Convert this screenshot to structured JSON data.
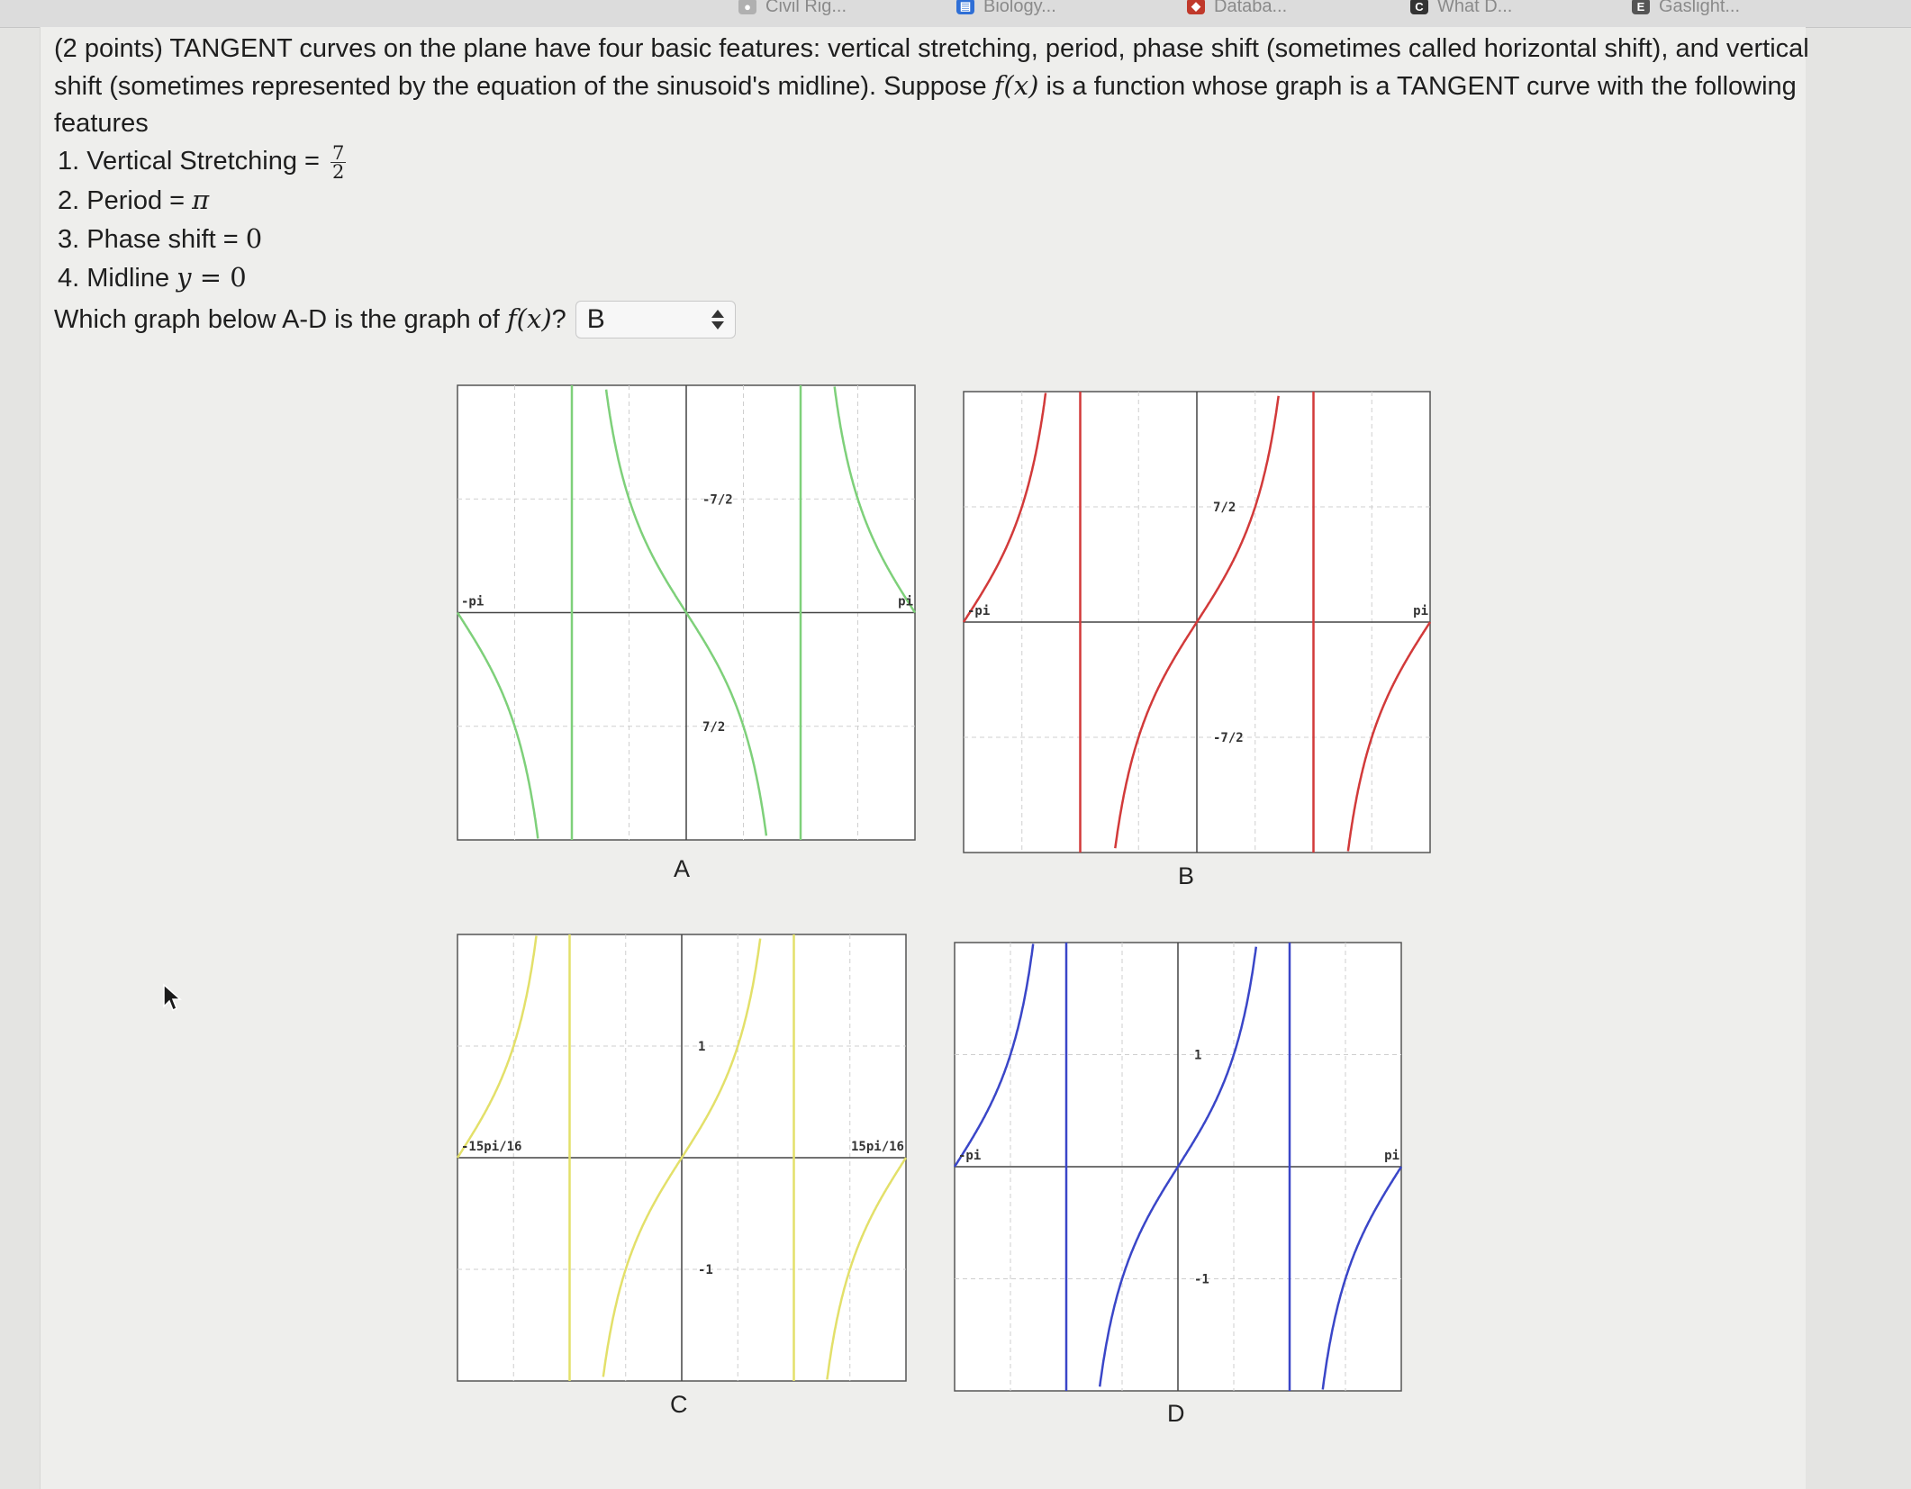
{
  "tabs": [
    {
      "label": "Civil Rig...",
      "icon": "tab-icon",
      "color": "#b0b0b0"
    },
    {
      "label": "Biology...",
      "icon": "book-icon",
      "color": "#2f6fd6"
    },
    {
      "label": "Databa...",
      "icon": "database-icon",
      "color": "#c0392b"
    },
    {
      "label": "What D...",
      "icon": "c-icon",
      "color": "#333333"
    },
    {
      "label": "Gaslight...",
      "icon": "e-icon",
      "color": "#555555"
    }
  ],
  "question": {
    "intro": "(2 points) TANGENT curves on the plane have four basic features: vertical stretching, period, phase shift (sometimes called horizontal shift), and vertical shift (sometimes represented by the equation of the sinusoid's midline). Suppose ",
    "func": "f(x)",
    "intro_end": " is a function whose graph is a TANGENT curve with the following features",
    "features": [
      {
        "label": "1. Vertical Stretching = ",
        "num": "7",
        "den": "2"
      },
      {
        "label": "2. Period = ",
        "value": "π"
      },
      {
        "label": "3. Phase shift = ",
        "value": "0"
      },
      {
        "label": "4. Midline ",
        "var": "y",
        "value": " = 0"
      }
    ],
    "ask": "Which graph below A-D is the graph of ",
    "ask_func": "f(x)",
    "ask_end": "?",
    "answer": "B"
  },
  "graphs": [
    {
      "id": "A",
      "label": "A",
      "color": "#7ed07a",
      "amp": -3.5,
      "ytop": "7/2",
      "ybot": "-7/2",
      "xleft": "-pi",
      "xright": "pi",
      "kind": "sec"
    },
    {
      "id": "B",
      "label": "B",
      "color": "#d23a3a",
      "amp": 3.5,
      "ytop": "7/2",
      "ybot": "-7/2",
      "xleft": "-pi",
      "xright": "pi",
      "kind": "tan"
    },
    {
      "id": "C",
      "label": "C",
      "color": "#e3e06a",
      "amp": 1,
      "ytop": "1",
      "ybot": "-1",
      "xleft": "-15pi/16",
      "xright": "15pi/16",
      "kind": "tan"
    },
    {
      "id": "D",
      "label": "D",
      "color": "#3a46c8",
      "amp": 1,
      "ytop": "1",
      "ybot": "-1",
      "xleft": "-pi",
      "xright": "pi",
      "kind": "tan"
    }
  ]
}
